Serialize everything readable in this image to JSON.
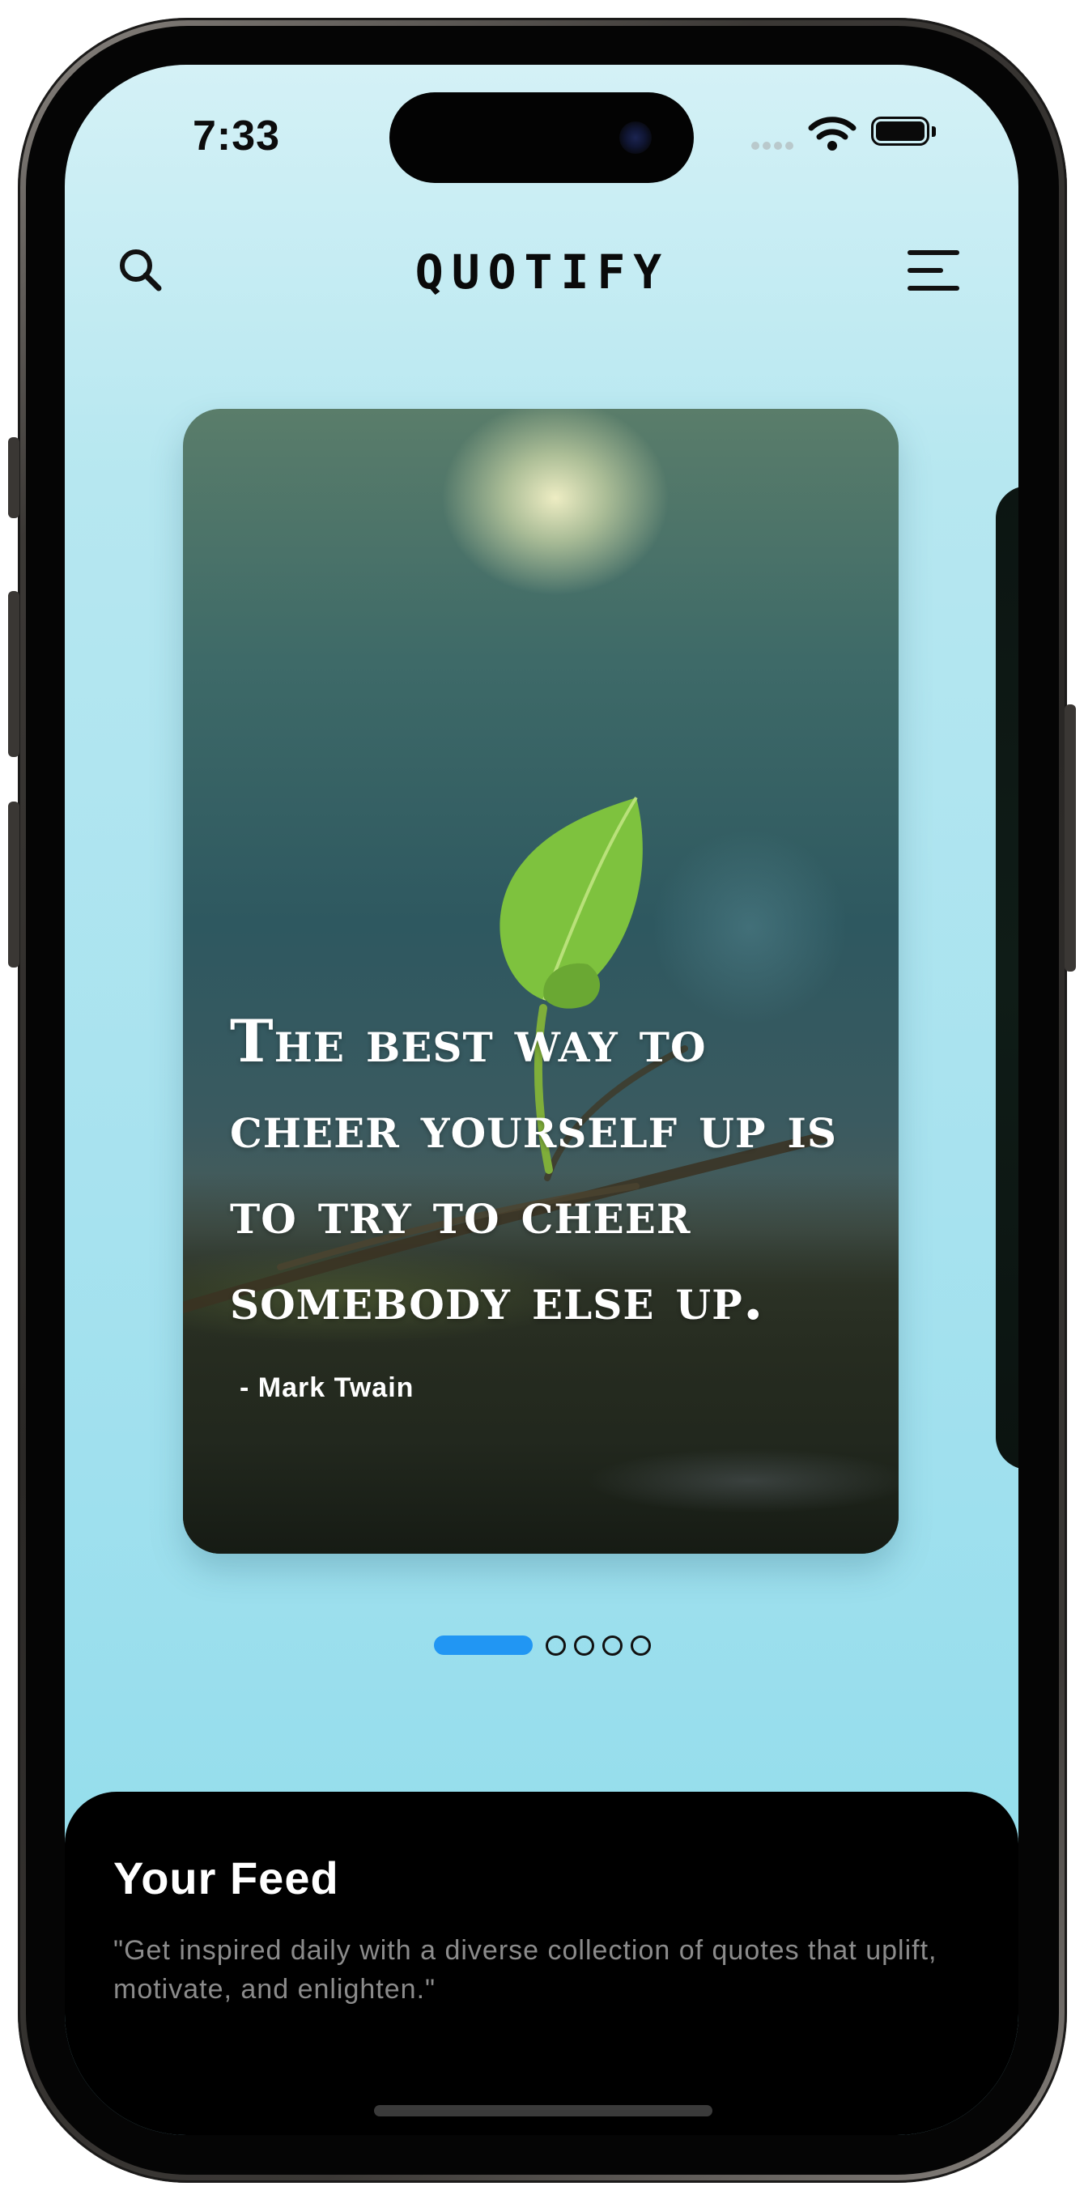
{
  "status_bar": {
    "time": "7:33"
  },
  "header": {
    "app_name": "QUOTIFY",
    "search_icon": "search-icon",
    "menu_icon": "menu-icon"
  },
  "carousel": {
    "quote": "The best way to cheer yourself up is to try to cheer somebody else up.",
    "author": "- Mark Twain",
    "page_count": 5,
    "active_page": 1,
    "active_color": "#2196f3"
  },
  "feed": {
    "title": "Your Feed",
    "description": "\"Get inspired daily with a diverse collection of quotes that uplift, motivate, and enlighten.\""
  },
  "colors": {
    "background_top": "#d4f1f6",
    "background_bottom": "#8ddbeb",
    "feed_panel": "#000000"
  }
}
